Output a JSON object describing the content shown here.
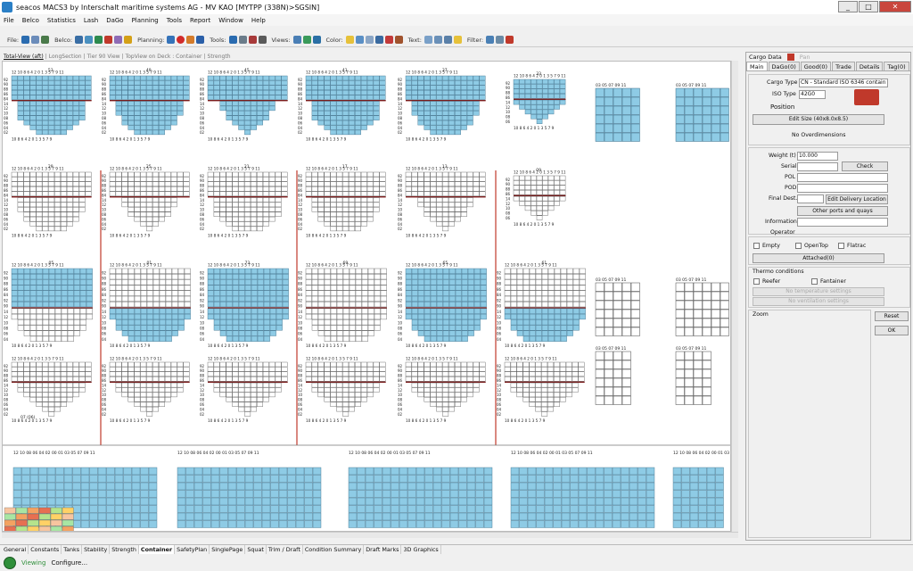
{
  "window": {
    "title": "seacos MACS3 by Interschalt maritime systems AG - MV KAO [MYTPP (338N)>SGSIN]",
    "min": "_",
    "max": "□",
    "close": "✕"
  },
  "menu": [
    "File",
    "Belco",
    "Statistics",
    "Lash",
    "DaGo",
    "Planning",
    "Tools",
    "Report",
    "Window",
    "Help"
  ],
  "toolbar": {
    "file": "File:",
    "belco": "Belco:",
    "planning": "Planning:",
    "tools": "Tools:",
    "views": "Views:",
    "color": "Color:",
    "text": "Text:",
    "filter": "Filter:"
  },
  "view_tabs": [
    "Total-View (aft)",
    "LongSection",
    "Tier 90 View",
    "TopView on Deck : Container",
    "Strength"
  ],
  "panel": {
    "title": "Cargo Data",
    "title2": "Pan",
    "tabs": [
      "Main",
      "DaGo(0)",
      "Good(0)",
      "Trade",
      "Details",
      "Tag(0)"
    ],
    "cargo_type_label": "Cargo Type",
    "cargo_type_value": "CN - Standard ISO 6346 contain",
    "iso_type_label": "ISO Type",
    "iso_type_value": "42G0",
    "position_label": "Position",
    "edit_size": "Edit Size (40x8.0x8.5)",
    "no_overdim": "No Overdimensions",
    "weight_label": "Weight (t)",
    "weight_value": "10.000",
    "serial_label": "Serial",
    "check": "Check",
    "pol_label": "POL",
    "pod_label": "POD",
    "final_dest_label": "Final Dest.",
    "edit_delivery": "Edit Delivery Location",
    "other_ports": "Other ports and quays",
    "information_label": "Information",
    "operator_label": "Operator",
    "empty": "Empty",
    "opentop": "OpenTop",
    "flatrac": "Flatrac",
    "attached": "Attached(0)",
    "thermo": "Thermo conditions",
    "reefer": "Reefer",
    "fantainer": "Fantainer",
    "no_temp": "No temperature settings",
    "no_vent": "No ventilation settings",
    "zoom": "Zoom",
    "reset": "Reset",
    "ok": "OK"
  },
  "bottom_tabs": [
    "General",
    "Constants",
    "Tanks",
    "Stability",
    "Strength",
    "Container",
    "SafetyPlan",
    "SinglePage",
    "Squat",
    "Trim / Draft",
    "Condition Summary",
    "Draft Marks",
    "3D Graphics"
  ],
  "status": {
    "viewing": "Viewing",
    "configure": "Configure..."
  },
  "bay_grid": {
    "col_labels": "12 10 8 6 4 2 0 1 3 5 7 9 11",
    "col_labels_small": "10 8 6 4 2 0 1 3 5 7 9",
    "tier_labels_deck": [
      "92",
      "90",
      "88",
      "86",
      "84"
    ],
    "tier_labels_hold": [
      "14",
      "12",
      "10",
      "08",
      "06",
      "04",
      "02"
    ],
    "right_cols": "03 05 07 09 11",
    "right_cols2": "12 10 08 06 04",
    "bottom_cols": "12 10 08 06 04 02 00 01 03 05 07 09 11",
    "cell_value": "10.0",
    "bay_numbers_row1": [
      "53",
      "49",
      "45",
      "41",
      "37",
      "33"
    ],
    "bay_numbers_row2": [
      "29",
      "25",
      "21",
      "17",
      "13",
      "09"
    ],
    "bay_numbers_row3": [
      "05",
      "01",
      "73",
      "69",
      "65",
      "61"
    ],
    "bottom_bay": "07 (06)"
  },
  "colors": {
    "filled": "#8ecbe5",
    "cellborder": "#3b6e8a",
    "hatch": "#7a1b1b",
    "redline": "#c0392b",
    "empty": "#ffffff"
  }
}
